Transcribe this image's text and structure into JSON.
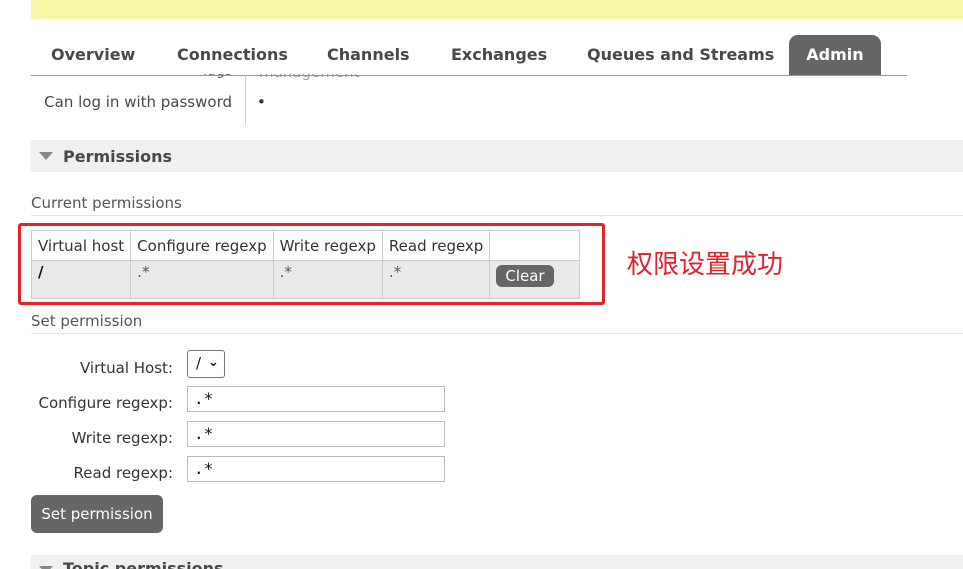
{
  "tabs": [
    {
      "label": "Overview"
    },
    {
      "label": "Connections"
    },
    {
      "label": "Channels"
    },
    {
      "label": "Exchanges"
    },
    {
      "label": "Queues and Streams"
    },
    {
      "label": "Admin",
      "active": true
    }
  ],
  "overview": {
    "tags_label": "Tags",
    "tags_value": "management",
    "login_label": "Can log in with password",
    "login_value": "•"
  },
  "permissions": {
    "section_title": "Permissions",
    "current_title": "Current permissions",
    "table": {
      "headers": [
        "Virtual host",
        "Configure regexp",
        "Write regexp",
        "Read regexp"
      ],
      "rows": [
        {
          "vhost": "/",
          "configure": ".*",
          "write": ".*",
          "read": ".*",
          "action": "Clear"
        }
      ]
    },
    "annotation": "权限设置成功"
  },
  "set_permission": {
    "title": "Set permission",
    "virtual_host_label": "Virtual Host:",
    "virtual_host_value": "/",
    "configure_label": "Configure regexp:",
    "configure_value": ".*",
    "write_label": "Write regexp:",
    "write_value": ".*",
    "read_label": "Read regexp:",
    "read_value": ".*",
    "button_label": "Set permission"
  },
  "topic_permissions": {
    "section_title": "Topic permissions"
  },
  "colors": {
    "banner": "#f7f6a4",
    "active_tab": "#666666",
    "annotation": "#e0242c"
  }
}
